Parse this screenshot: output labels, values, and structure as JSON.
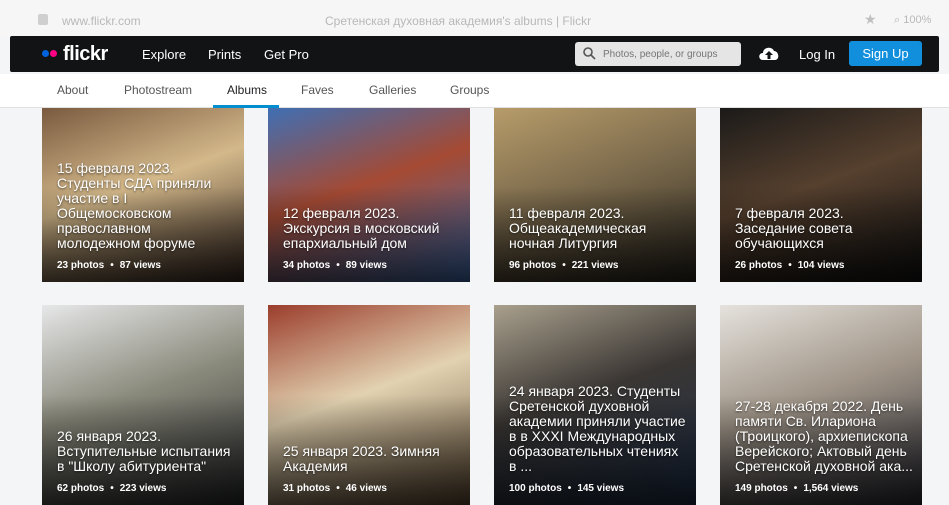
{
  "browser": {
    "url": "www.flickr.com",
    "title": "Сретенская духовная академия's albums | Flickr",
    "zoom": "100%"
  },
  "header": {
    "logo": "flickr",
    "nav": [
      "Explore",
      "Prints",
      "Get Pro"
    ],
    "search_placeholder": "Photos, people, or groups",
    "login": "Log In",
    "signup": "Sign Up"
  },
  "subnav": {
    "tabs": [
      "About",
      "Photostream",
      "Albums",
      "Faves",
      "Galleries",
      "Groups"
    ],
    "active": "Albums"
  },
  "albums": [
    {
      "title": "15 февраля 2023. Студенты СДА приняли участие в I Общемосковском православном молодежном форуме",
      "photos": "23 photos",
      "views": "87 views",
      "colors": [
        "#7a5a3f",
        "#d3b88a",
        "#3a2a22"
      ]
    },
    {
      "title": "12 февраля 2023. Экскурсия в московский епархиальный дом",
      "photos": "34 photos",
      "views": "89 views",
      "colors": [
        "#3f6fb4",
        "#a54a33",
        "#3f6fb4"
      ]
    },
    {
      "title": "11 февраля 2023. Общеакадемическая ночная Литургия",
      "photos": "96 photos",
      "views": "221 views",
      "colors": [
        "#b79c6a",
        "#7b6a4c",
        "#2a261f"
      ]
    },
    {
      "title": "7 февраля 2023. Заседание совета обучающихся",
      "photos": "26 photos",
      "views": "104 views",
      "colors": [
        "#1b1a19",
        "#56402e",
        "#121212"
      ]
    },
    {
      "title": "26 января 2023. Вступительные испытания в \"Школу абитуриента\"",
      "photos": "62 photos",
      "views": "223 views",
      "colors": [
        "#e6e7e8",
        "#8a8a7c",
        "#2a2b2e"
      ]
    },
    {
      "title": "25 января 2023. Зимняя Академия",
      "photos": "31 photos",
      "views": "46 views",
      "colors": [
        "#9b3d2c",
        "#e2d2b1",
        "#5f4b34"
      ]
    },
    {
      "title": "24 января 2023. Студенты Сретенской духовной академии приняли участие в в XXXI Международных образовательных чтениях в ...",
      "photos": "100 photos",
      "views": "145 views",
      "colors": [
        "#a9a08d",
        "#3a3633",
        "#1e2f49"
      ]
    },
    {
      "title": "27-28 декабря 2022. День памяти Св. Илариона (Троицкого), архиепископа Верейского; Актовый день Сретенской духовной ака...",
      "photos": "149 photos",
      "views": "1,564 views",
      "colors": [
        "#e5e2dd",
        "#a09588",
        "#2b2c35"
      ]
    }
  ]
}
